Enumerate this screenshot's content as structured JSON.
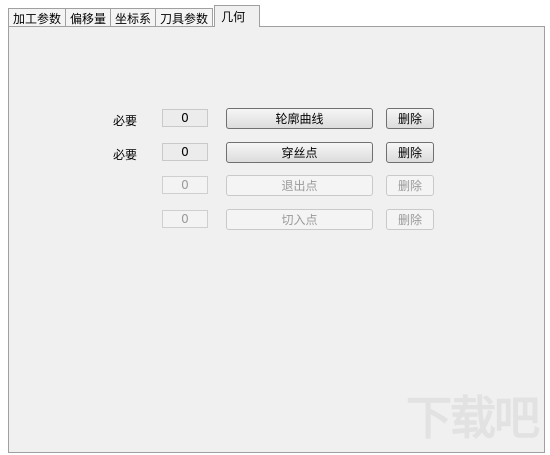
{
  "tabs": [
    {
      "label": "加工参数"
    },
    {
      "label": "偏移量"
    },
    {
      "label": "坐标系"
    },
    {
      "label": "刀具参数"
    },
    {
      "label": "几何"
    }
  ],
  "rows": [
    {
      "label": "必要",
      "value": "0",
      "button": "轮廓曲线",
      "delete": "删除",
      "enabled": true
    },
    {
      "label": "必要",
      "value": "0",
      "button": "穿丝点",
      "delete": "删除",
      "enabled": true
    },
    {
      "label": "",
      "value": "0",
      "button": "退出点",
      "delete": "删除",
      "enabled": false
    },
    {
      "label": "",
      "value": "0",
      "button": "切入点",
      "delete": "删除",
      "enabled": false
    }
  ],
  "watermark": "下载吧"
}
